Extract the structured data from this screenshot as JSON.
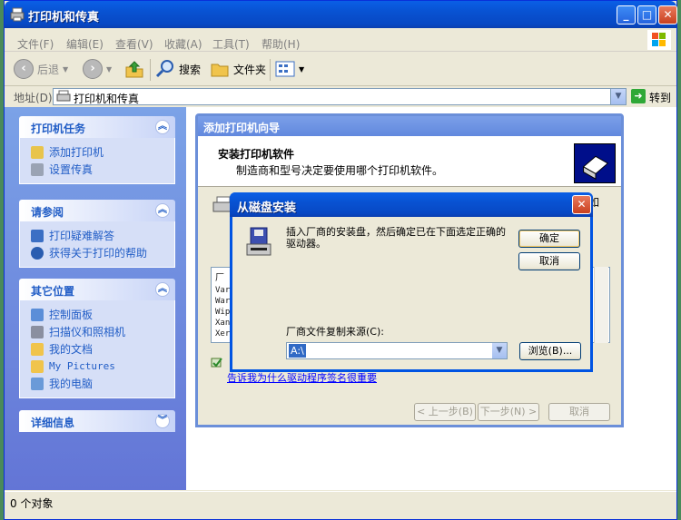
{
  "window": {
    "title": "打印机和传真",
    "controls": {
      "minimize": "_",
      "maximize": "□",
      "close": "✕"
    }
  },
  "menu": [
    "文件(F)",
    "编辑(E)",
    "查看(V)",
    "收藏(A)",
    "工具(T)",
    "帮助(H)"
  ],
  "toolbar": {
    "back": "后退",
    "search": "搜索",
    "folders": "文件夹",
    "back_icon": "back-arrow-icon",
    "forward_icon": "forward-arrow-icon",
    "up_icon": "up-folder-icon"
  },
  "address": {
    "label": "地址(D)",
    "value": "打印机和传真",
    "go": "转到"
  },
  "tasks": {
    "printer_tasks": {
      "title": "打印机任务",
      "items": [
        "添加打印机",
        "设置传真"
      ]
    },
    "see_also": {
      "title": "请参阅",
      "items": [
        "打印疑难解答",
        "获得关于打印的帮助"
      ]
    },
    "other_places": {
      "title": "其它位置",
      "items": [
        "控制面板",
        "扫描仪和照相机",
        "我的文档",
        "My Pictures",
        "我的电脑"
      ]
    },
    "details": {
      "title": "详细信息"
    }
  },
  "wizard": {
    "title": "添加打印机向导",
    "heading": "安装打印机软件",
    "subheading": "制造商和型号决定要使用哪个打印机软件。",
    "peek_text": "如",
    "list_header": "厂",
    "list_rows": [
      "Var",
      "War",
      "Wip",
      "Xan",
      "Xer"
    ],
    "link": "告诉我为什么驱动程序签名很重要",
    "buttons": {
      "back": "< 上一步(B)",
      "next": "下一步(N) >",
      "cancel": "取消"
    }
  },
  "dialog": {
    "title": "从磁盘安装",
    "message": "插入厂商的安装盘，然后确定已在下面选定正确的驱动器。",
    "ok": "确定",
    "cancel": "取消",
    "source_label": "厂商文件复制来源(C):",
    "source_value": "A:\\",
    "browse": "浏览(B)..."
  },
  "status": {
    "text": "0 个对象"
  },
  "colors": {
    "accent": "#0054e3",
    "link": "#215dc6",
    "panel": "#d6dff7"
  }
}
